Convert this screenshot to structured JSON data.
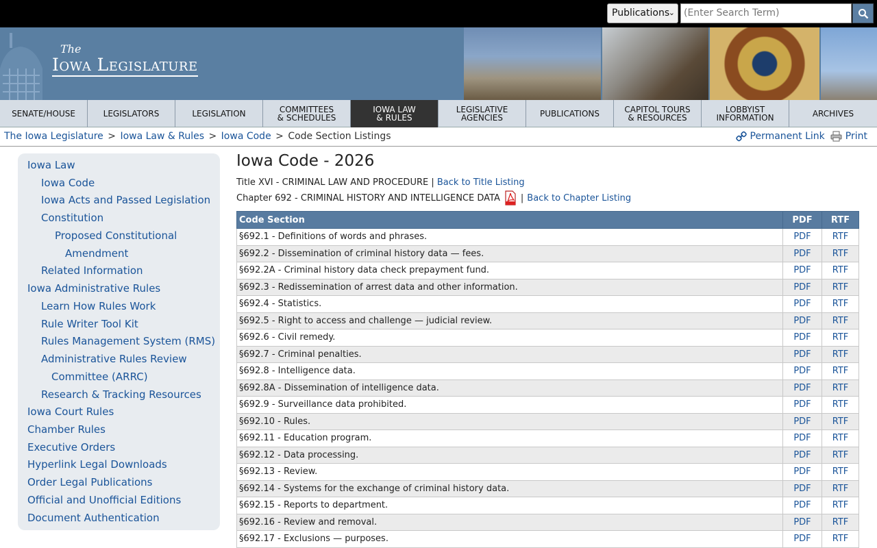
{
  "search": {
    "select_value": "Publications",
    "placeholder": "(Enter Search Term)"
  },
  "banner": {
    "logo_the": "The",
    "logo_main": "Iowa Legislature"
  },
  "nav": [
    {
      "label": "SENATE/HOUSE"
    },
    {
      "label": "LEGISLATORS"
    },
    {
      "label": "LEGISLATION"
    },
    {
      "label": "COMMITTEES & SCHEDULES"
    },
    {
      "label": "IOWA LAW & RULES"
    },
    {
      "label": "LEGISLATIVE AGENCIES"
    },
    {
      "label": "PUBLICATIONS"
    },
    {
      "label": "CAPITOL TOURS & RESOURCES"
    },
    {
      "label": "LOBBYIST INFORMATION"
    },
    {
      "label": "ARCHIVES"
    }
  ],
  "breadcrumb": {
    "items": [
      "The Iowa Legislature",
      "Iowa Law & Rules",
      "Iowa Code"
    ],
    "separator": ">",
    "current": "Code Section Listings"
  },
  "tools": {
    "permalink": "Permanent Link",
    "print": "Print"
  },
  "sidebar": {
    "items": [
      {
        "label": "Iowa Law"
      },
      {
        "label": "Iowa Code"
      },
      {
        "label": "Iowa Acts and Passed Legislation"
      },
      {
        "label": "Constitution"
      },
      {
        "label": "Proposed Constitutional"
      },
      {
        "label": "Amendment"
      },
      {
        "label": "Related Information"
      },
      {
        "label": "Iowa Administrative Rules"
      },
      {
        "label": "Learn How Rules Work"
      },
      {
        "label": "Rule Writer Tool Kit"
      },
      {
        "label": "Rules Management System (RMS)"
      },
      {
        "label": "Administrative Rules Review"
      },
      {
        "label": "Committee (ARRC)"
      },
      {
        "label": "Research & Tracking Resources"
      },
      {
        "label": "Iowa Court Rules"
      },
      {
        "label": "Chamber Rules"
      },
      {
        "label": "Executive Orders"
      },
      {
        "label": "Hyperlink Legal Downloads"
      },
      {
        "label": "Order Legal Publications"
      },
      {
        "label": "Official and Unofficial Editions"
      },
      {
        "label": "Document Authentication"
      }
    ]
  },
  "main": {
    "title": "Iowa Code - 2026",
    "title_line": "Title XVI - CRIMINAL LAW AND PROCEDURE",
    "pipe": "|",
    "back_title": "Back to Title Listing",
    "chapter_line": "Chapter 692 - CRIMINAL HISTORY AND INTELLIGENCE DATA",
    "back_chapter": "Back to Chapter Listing"
  },
  "table": {
    "headers": [
      "Code Section",
      "PDF",
      "RTF"
    ],
    "rows": [
      {
        "section": "§692.1 - Definitions of words and phrases.",
        "pdf": "PDF",
        "rtf": "RTF"
      },
      {
        "section": "§692.2 - Dissemination of criminal history data — fees.",
        "pdf": "PDF",
        "rtf": "RTF"
      },
      {
        "section": "§692.2A - Criminal history data check prepayment fund.",
        "pdf": "PDF",
        "rtf": "RTF"
      },
      {
        "section": "§692.3 - Redissemination of arrest data and other information.",
        "pdf": "PDF",
        "rtf": "RTF"
      },
      {
        "section": "§692.4 - Statistics.",
        "pdf": "PDF",
        "rtf": "RTF"
      },
      {
        "section": "§692.5 - Right to access and challenge — judicial review.",
        "pdf": "PDF",
        "rtf": "RTF"
      },
      {
        "section": "§692.6 - Civil remedy.",
        "pdf": "PDF",
        "rtf": "RTF"
      },
      {
        "section": "§692.7 - Criminal penalties.",
        "pdf": "PDF",
        "rtf": "RTF"
      },
      {
        "section": "§692.8 - Intelligence data.",
        "pdf": "PDF",
        "rtf": "RTF"
      },
      {
        "section": "§692.8A - Dissemination of intelligence data.",
        "pdf": "PDF",
        "rtf": "RTF"
      },
      {
        "section": "§692.9 - Surveillance data prohibited.",
        "pdf": "PDF",
        "rtf": "RTF"
      },
      {
        "section": "§692.10 - Rules.",
        "pdf": "PDF",
        "rtf": "RTF"
      },
      {
        "section": "§692.11 - Education program.",
        "pdf": "PDF",
        "rtf": "RTF"
      },
      {
        "section": "§692.12 - Data processing.",
        "pdf": "PDF",
        "rtf": "RTF"
      },
      {
        "section": "§692.13 - Review.",
        "pdf": "PDF",
        "rtf": "RTF"
      },
      {
        "section": "§692.14 - Systems for the exchange of criminal history data.",
        "pdf": "PDF",
        "rtf": "RTF"
      },
      {
        "section": "§692.15 - Reports to department.",
        "pdf": "PDF",
        "rtf": "RTF"
      },
      {
        "section": "§692.16 - Review and removal.",
        "pdf": "PDF",
        "rtf": "RTF"
      },
      {
        "section": "§692.17 - Exclusions — purposes.",
        "pdf": "PDF",
        "rtf": "RTF"
      }
    ]
  },
  "colors": {
    "banner": "#5a7fa2",
    "link": "#1a5499",
    "table_header": "#587ba0",
    "nav_active": "#333333"
  }
}
